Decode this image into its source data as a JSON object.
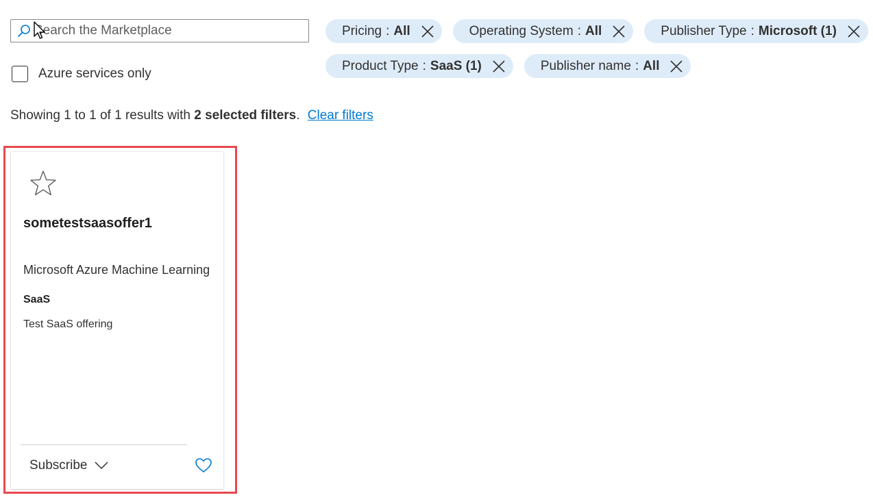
{
  "search": {
    "placeholder": "Search the Marketplace",
    "value": ""
  },
  "azure_only": {
    "label": "Azure services only",
    "checked": false
  },
  "filters_row1": [
    {
      "name": "Pricing",
      "value": "All"
    },
    {
      "name": "Operating System",
      "value": "All"
    },
    {
      "name": "Publisher Type",
      "value": "Microsoft (1)"
    }
  ],
  "filters_row2": [
    {
      "name": "Product Type",
      "value": "SaaS (1)"
    },
    {
      "name": "Publisher name",
      "value": "All"
    }
  ],
  "filter_separator": ":",
  "results": {
    "prefix": "Showing 1 to 1 of 1 results with",
    "selected": "2 selected filters",
    "suffix": ".",
    "clear_link": "Clear filters"
  },
  "card": {
    "title": "sometestsaasoffer1",
    "publisher": "Microsoft Azure Machine Learning",
    "product_type": "SaaS",
    "description": "Test SaaS offering",
    "action_label": "Subscribe"
  },
  "colors": {
    "accent": "#0078d4",
    "pill_bg": "#deecf9",
    "highlight": "#e8484e"
  }
}
